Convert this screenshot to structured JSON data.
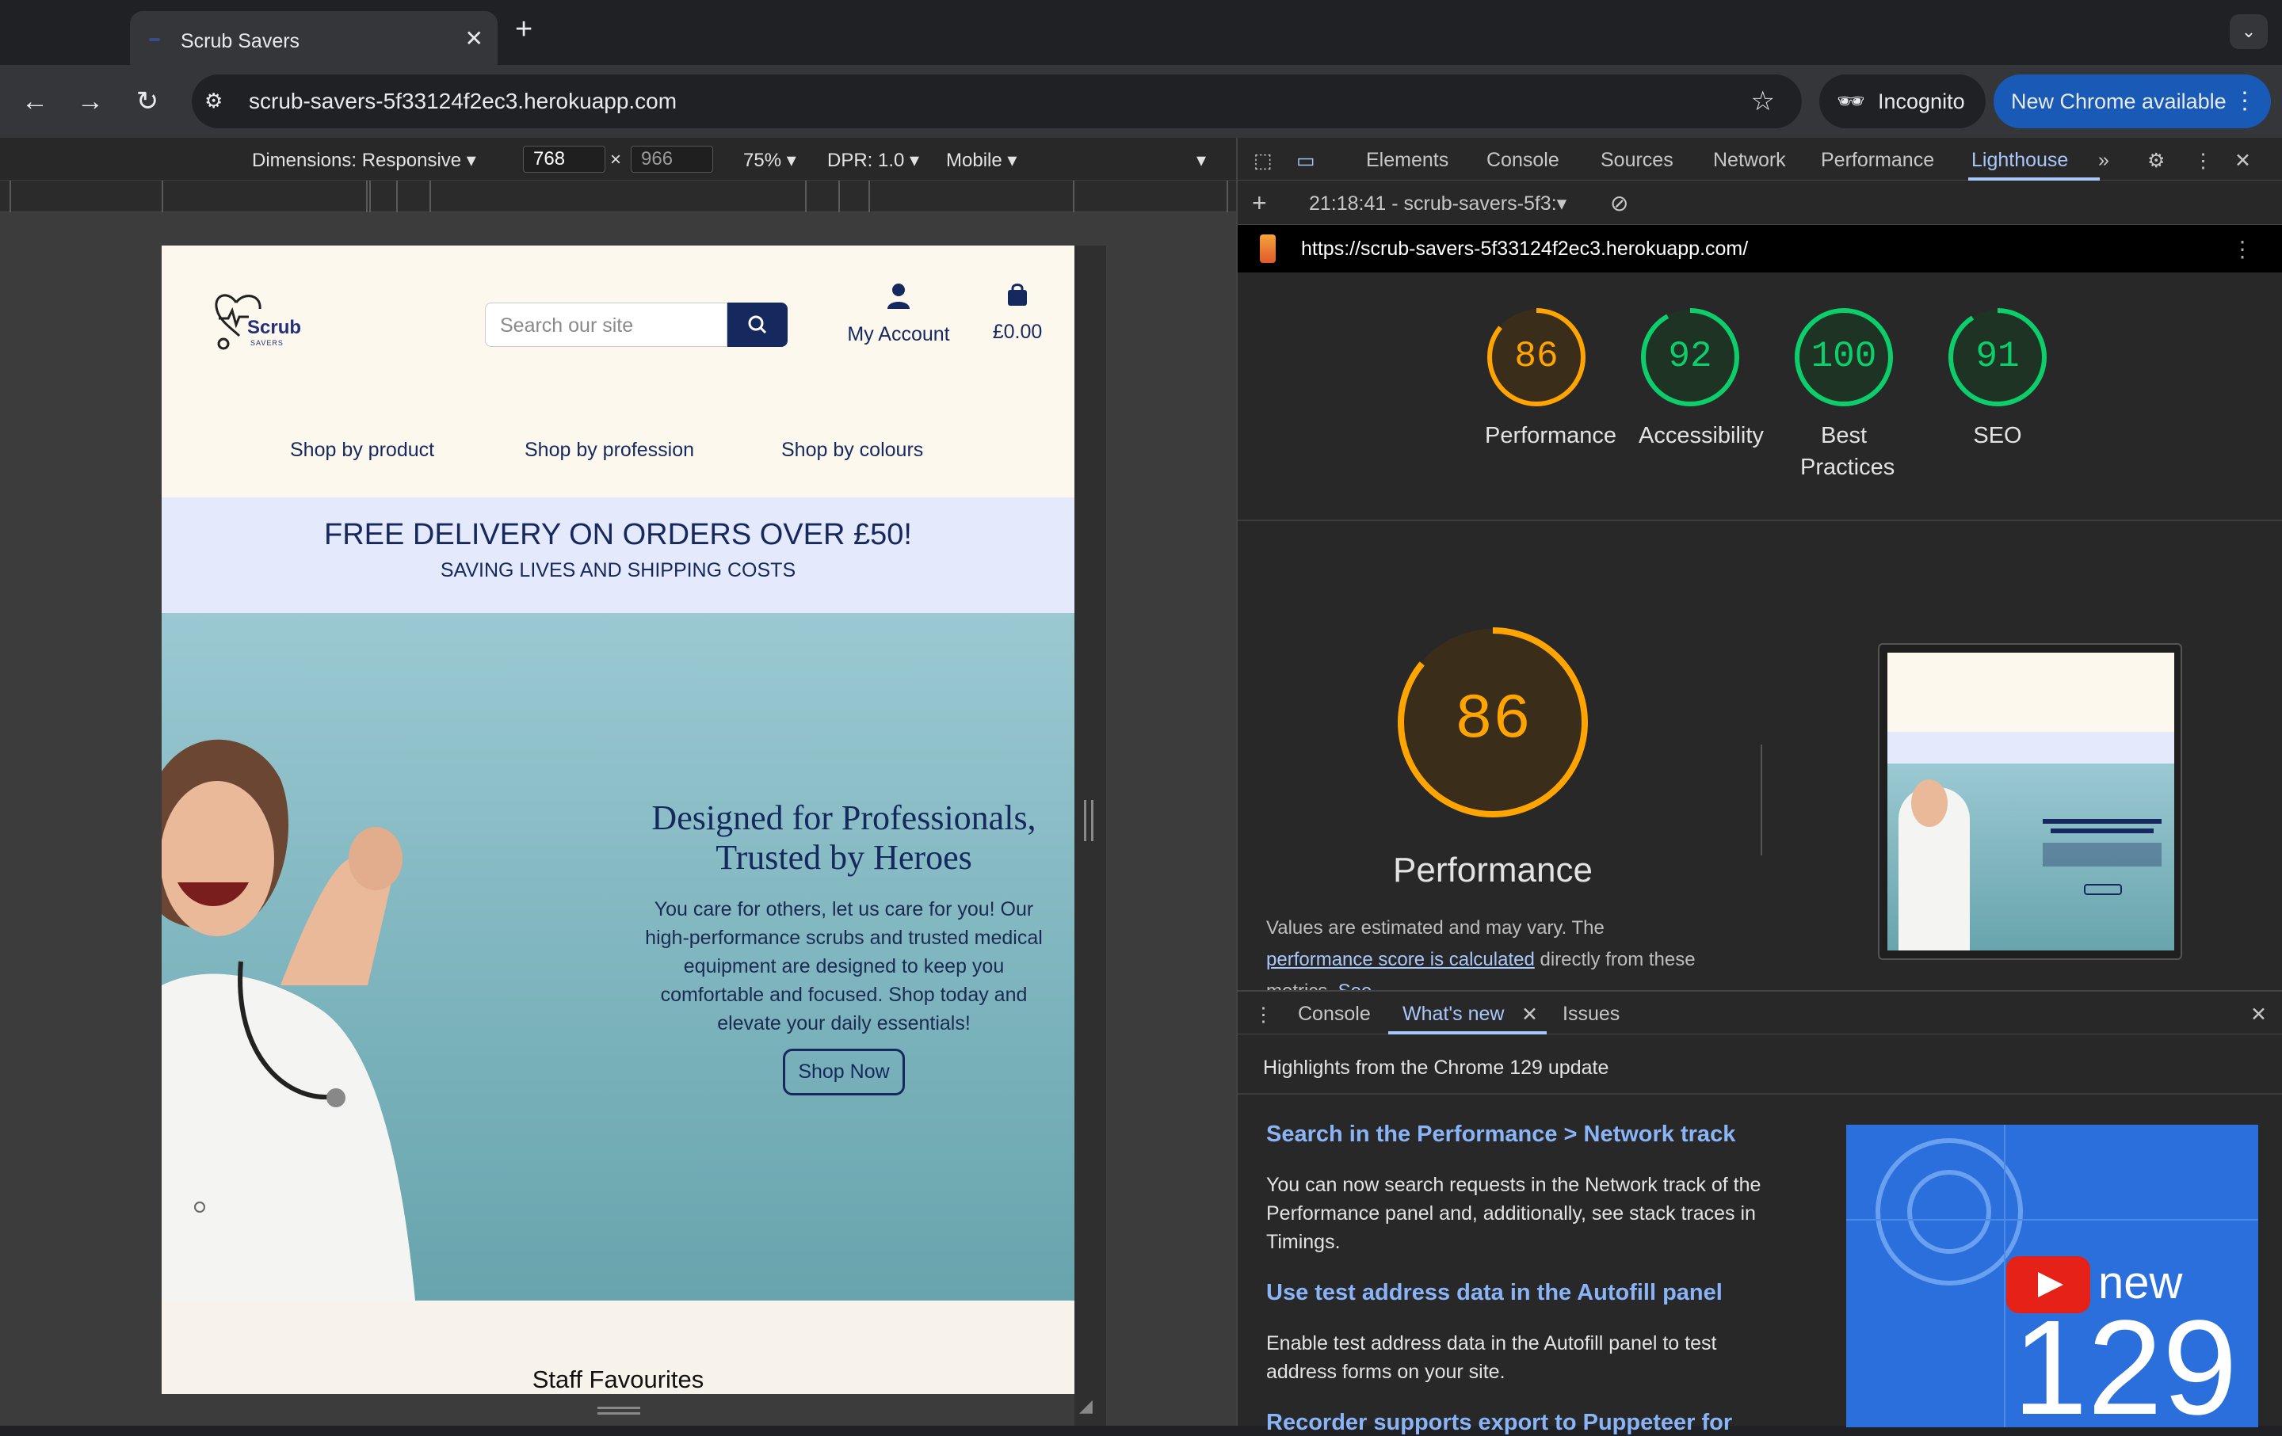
{
  "browser": {
    "tab_title": "Scrub Savers",
    "tab_close": "✕",
    "new_tab": "+",
    "url": "scrub-savers-5f33124f2ec3.herokuapp.com",
    "incognito_label": "Incognito",
    "new_chrome_label": "New Chrome available"
  },
  "device_toolbar": {
    "dimensions_label": "Dimensions: Responsive",
    "width": "768",
    "times": "×",
    "height": "966",
    "zoom": "75%",
    "dpr": "DPR: 1.0",
    "device_type": "Mobile"
  },
  "site": {
    "logo_text": "Scrub",
    "logo_sub": "SAVERS",
    "search_placeholder": "Search our site",
    "account_label": "My Account",
    "cart_total": "£0.00",
    "nav": [
      "Shop by product",
      "Shop by profession",
      "Shop by colours"
    ],
    "banner_heading": "FREE DELIVERY ON ORDERS OVER £50!",
    "banner_sub": "SAVING LIVES AND SHIPPING COSTS",
    "hero_heading": "Designed for Professionals, Trusted by Heroes",
    "hero_text": "You care for others, let us care for you! Our high-performance scrubs and trusted medical equipment are designed to keep you comfortable and focused. Shop today and elevate your daily essentials!",
    "hero_button": "Shop Now",
    "staff_title": "Staff Favourites"
  },
  "devtools": {
    "tabs": [
      "Elements",
      "Console",
      "Sources",
      "Network",
      "Performance",
      "Lighthouse"
    ],
    "active_tab": "Lighthouse",
    "report_label": "21:18:41 - scrub-savers-5f3:",
    "report_url": "https://scrub-savers-5f33124f2ec3.herokuapp.com/",
    "scores": [
      {
        "label": "Performance",
        "value": 86,
        "color": "#ffa400"
      },
      {
        "label": "Accessibility",
        "value": 92,
        "color": "#0cce6b"
      },
      {
        "label": "Best Practices",
        "value": 100,
        "color": "#0cce6b"
      },
      {
        "label": "SEO",
        "value": 91,
        "color": "#0cce6b"
      }
    ],
    "big_score": "86",
    "big_label": "Performance",
    "perf_note_a": "Values are estimated and may vary. The ",
    "perf_note_link": "performance score is calculated",
    "perf_note_b": " directly from these metrics. ",
    "perf_note_link2": "See"
  },
  "drawer": {
    "tabs": [
      "Console",
      "What's new",
      "Issues"
    ],
    "active_tab": "What's new",
    "highlights": "Highlights from the Chrome 129 update",
    "features": [
      {
        "title": "Search in the Performance > Network track",
        "text": "You can now search requests in the Network track of the Performance panel and, additionally, see stack traces in Timings."
      },
      {
        "title": "Use test address data in the Autofill panel",
        "text": "Enable test address data in the Autofill panel to test address forms on your site."
      },
      {
        "title": "Recorder supports export to Puppeteer for",
        "text": ""
      }
    ],
    "video_new": "new",
    "video_version": "129"
  }
}
